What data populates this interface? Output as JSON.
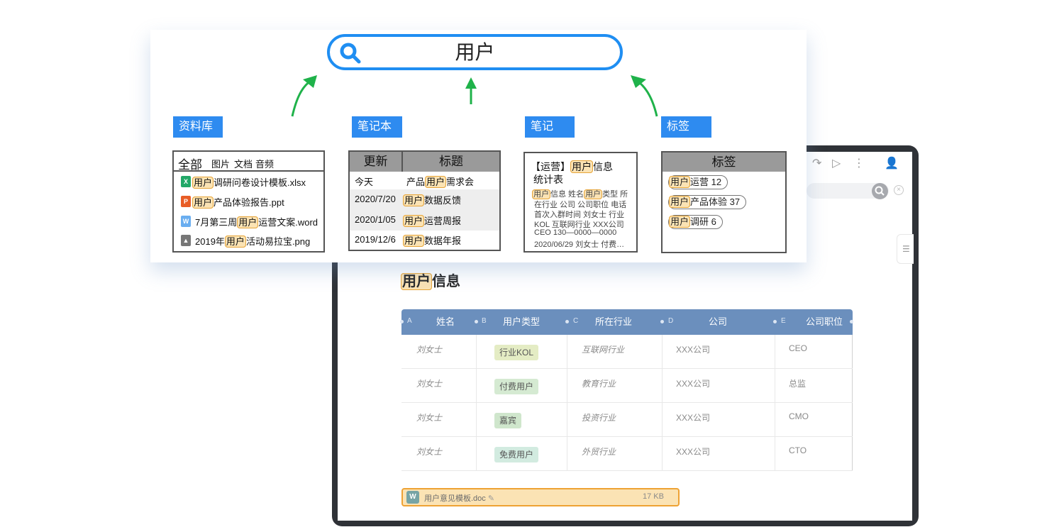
{
  "search": {
    "query": "用户"
  },
  "categories": {
    "library": "资料库",
    "notebook": "笔记本",
    "note": "笔记",
    "tag": "标签"
  },
  "library": {
    "tabs": {
      "all": "全部",
      "images": "图片",
      "docs": "文档",
      "audio": "音频"
    },
    "files": [
      {
        "icon": "excel-icon",
        "pre": "",
        "hl": "用户",
        "post": "调研问卷设计模板.xlsx"
      },
      {
        "icon": "ppt-icon",
        "pre": "",
        "hl": "用户",
        "post": "产品体验报告.ppt"
      },
      {
        "icon": "word-icon",
        "pre": "7月第三周",
        "hl": "用户",
        "post": "运营文案.word"
      },
      {
        "icon": "image-icon",
        "pre": "2019年",
        "hl": "用户",
        "post": "活动易拉宝.png"
      }
    ]
  },
  "notebook": {
    "headers": {
      "updated": "更新",
      "title": "标题"
    },
    "rows": [
      {
        "date": "今天",
        "pre": "产品",
        "hl": "用户",
        "post": "需求会"
      },
      {
        "date": "2020/7/20",
        "pre": "",
        "hl": "用户",
        "post": "数据反馈"
      },
      {
        "date": "2020/1/05",
        "pre": "",
        "hl": "用户",
        "post": "运营周报"
      },
      {
        "date": "2019/12/6",
        "pre": "",
        "hl": "用户",
        "post": "数据年报"
      }
    ]
  },
  "note": {
    "title_pre": "【运营】",
    "title_hl": "用户",
    "title_post": "信息",
    "title_line2": "统计表",
    "body_hl1": "用户",
    "body_1": "信息 姓名",
    "body_hl2": "用户",
    "body_2": "类型 所",
    "body_lines": [
      "在行业 公司 公司职位 电话",
      "首次入群时间 刘女士 行业",
      "KOL 互联网行业 XXX公司",
      "CEO 130—0000—0000",
      "2020/06/29 刘女士 付费…"
    ]
  },
  "tags": {
    "header": "标签",
    "items": [
      {
        "hl": "用户",
        "text": "运营 12"
      },
      {
        "hl": "用户",
        "text": "产品体验 37"
      },
      {
        "hl": "用户",
        "text": "调研 6"
      }
    ]
  },
  "document": {
    "title_hl": "用户",
    "title_rest": "信息",
    "columns": [
      {
        "letter": "A",
        "name": "姓名"
      },
      {
        "letter": "B",
        "name": "用户类型"
      },
      {
        "letter": "C",
        "name": "所在行业"
      },
      {
        "letter": "D",
        "name": "公司"
      },
      {
        "letter": "E",
        "name": "公司职位"
      }
    ],
    "rows": [
      {
        "name": "刘女士",
        "type": "行业KOL",
        "industry": "互联网行业",
        "company": "XXX公司",
        "position": "CEO",
        "tag_color": "#e4ecc4"
      },
      {
        "name": "刘女士",
        "type": "付费用户",
        "industry": "教育行业",
        "company": "XXX公司",
        "position": "总监",
        "tag_color": "#d5ead2"
      },
      {
        "name": "刘女士",
        "type": "嘉宾",
        "industry": "投资行业",
        "company": "XXX公司",
        "position": "CMO",
        "tag_color": "#cfe6cc"
      },
      {
        "name": "刘女士",
        "type": "免费用户",
        "industry": "外贸行业",
        "company": "XXX公司",
        "position": "CTO",
        "tag_color": "#d2ebe0"
      }
    ],
    "attachment": {
      "icon_letter": "W",
      "name": "用户意见模板.doc",
      "size": "17 KB"
    }
  },
  "colors": {
    "accent_blue": "#1f8ef2",
    "arrow_green": "#1fb24a",
    "highlight": "#fbe3b4",
    "table_header": "#6b8fbd"
  }
}
